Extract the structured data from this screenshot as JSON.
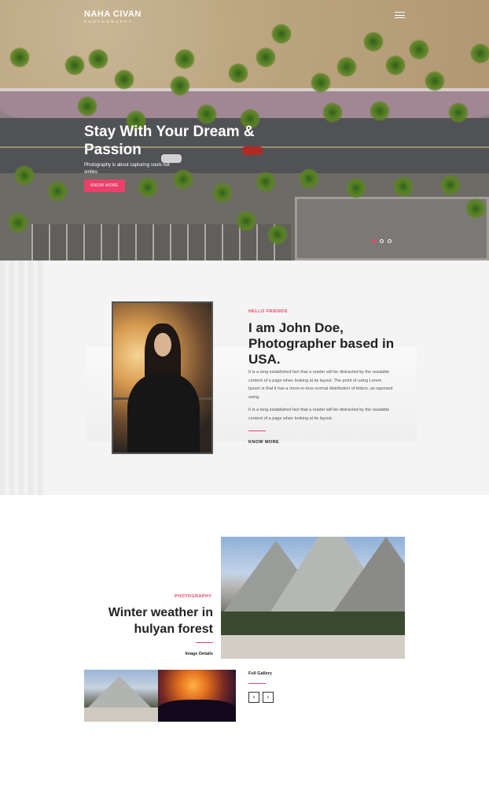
{
  "header": {
    "logo_name": "NAHA CIVAN",
    "logo_sub": "PHOTOGRAPHY",
    "menu_icon": "hamburger-menu-icon"
  },
  "hero": {
    "title": "Stay With Your Dream & Passion",
    "subtitle": "Photography is about capturing souls not smiles",
    "button_label": "KNOW MORE",
    "slides": 3,
    "active_slide": 1
  },
  "about": {
    "kicker": "HELLO FRIENDS",
    "title": "I am John Doe, Photographer based in USA.",
    "paragraph1": "It is a long established fact that a reader will be distracted by the readable content of a page when looking at its layout. The point of using Lorem Ipsum is that it has a more-or-less normal distribution of letters, as opposed using.",
    "paragraph2": "It is a long established fact that a reader will be distracted by the readable content of a page when looking at its layout.",
    "link_label": "KNOW MORE"
  },
  "gallery": {
    "category": "PHOTOGRAPHY",
    "title": "Winter weather in hulyan forest",
    "details_link": "Image Details",
    "full_gallery_link": "Full Gallery",
    "prev_icon": "chevron-left-icon",
    "next_icon": "chevron-right-icon",
    "prev_glyph": "‹",
    "next_glyph": "›"
  },
  "colors": {
    "accent": "#ec3f6a",
    "text_dark": "#222222",
    "about_bg": "#f4f4f4"
  }
}
